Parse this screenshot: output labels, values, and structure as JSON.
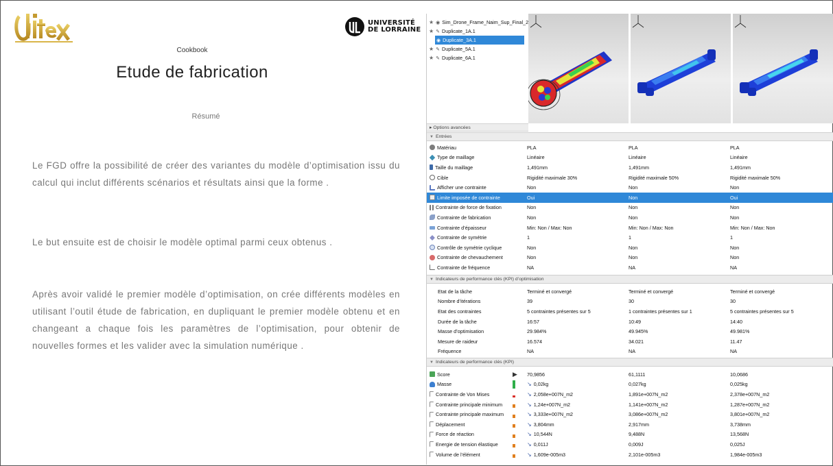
{
  "left": {
    "logo_ditex": "Ditex",
    "logo_ul": "UNIVERSITÉ\nDE LORRAINE",
    "ul_line1": "UNIVERSITÉ",
    "ul_line2": "DE LORRAINE",
    "cookbook": "Cookbook",
    "title": "Etude de fabrication",
    "resume": "Résumé",
    "paragraph1": "Le FGD offre la possibilité de créer des variantes du modèle d’optimisation issu du calcul qui inclut différents scénarios et résultats ainsi que la forme .",
    "paragraph2": " Le but ensuite est de choisir le modèle optimal parmi ceux obtenus .",
    "paragraph3": "Après avoir validé le premier modèle d’optimisation, on crée différents modèles en utilisant l’outil étude de fabrication, en dupliquant le premier modèle obtenu et en changeant a chaque fois les paramètres de l’optimisation, pour obtenir de nouvelles formes et les valider avec la simulation numérique ."
  },
  "tree": {
    "items": [
      {
        "label": "Sim_Drone_Frame_Naim_Sup_Final_2",
        "icon": "eye-icon"
      },
      {
        "label": "Duplicate_1A.1",
        "icon": "pin-icon"
      },
      {
        "label": "Duplicate_3A.1",
        "icon": "eye-icon",
        "selected": true
      },
      {
        "label": "Duplicate_5A.1",
        "icon": "pin-icon"
      },
      {
        "label": "Duplicate_6A.1",
        "icon": "pin-icon"
      }
    ],
    "options": "Options avancées"
  },
  "sections": {
    "entrees": "Entrées",
    "kpi_opt": "Indicateurs de performance clés (KPI) d’optimisation",
    "kpi": "Indicateurs de performance clés (KPI)"
  },
  "entrees": [
    {
      "label": "Matériau",
      "icon": "gear-icon",
      "v": [
        "PLA",
        "PLA",
        "PLA"
      ]
    },
    {
      "label": "Type de maillage",
      "icon": "mesh-icon",
      "v": [
        "Linéaire",
        "Linéaire",
        "Linéaire"
      ]
    },
    {
      "label": "Taille du maillage",
      "icon": "size-icon",
      "v": [
        "1,491mm",
        "1,491mm",
        "1,491mm"
      ]
    },
    {
      "label": "Cible",
      "icon": "target-icon",
      "v": [
        "Rigidité maximale 30%",
        "Rigidité maximale 50%",
        "Rigidité maximale 50%"
      ]
    },
    {
      "label": "Afficher une contrainte",
      "icon": "show-icon",
      "v": [
        "Non",
        "Non",
        "Non"
      ]
    },
    {
      "label": "Limite imposée de contrainte",
      "icon": "limit-icon",
      "v": [
        "Oui",
        "Non",
        "Oui"
      ],
      "highlight": true
    },
    {
      "label": "Contrainte de force de fixation",
      "icon": "fixation-icon",
      "v": [
        "Non",
        "Non",
        "Non"
      ]
    },
    {
      "label": "Contrainte de fabrication",
      "icon": "fabrication-icon",
      "v": [
        "Non",
        "Non",
        "Non"
      ]
    },
    {
      "label": "Contrainte d’épaisseur",
      "icon": "thickness-icon",
      "v": [
        "Min: Non / Max: Non",
        "Min: Non / Max: Non",
        "Min: Non / Max: Non"
      ]
    },
    {
      "label": "Contrainte de symétrie",
      "icon": "symmetry-icon",
      "v": [
        "1",
        "1",
        "1"
      ]
    },
    {
      "label": "Contrôle de symétrie cyclique",
      "icon": "cyclic-icon",
      "v": [
        "Non",
        "Non",
        "Non"
      ]
    },
    {
      "label": "Contrainte de chevauchement",
      "icon": "overlap-icon",
      "v": [
        "Non",
        "Non",
        "Non"
      ]
    },
    {
      "label": "Contrainte de fréquence",
      "icon": "frequency-icon",
      "v": [
        "NA",
        "NA",
        "NA"
      ]
    }
  ],
  "kpi_opt": [
    {
      "label": "Etat de la tâche",
      "v": [
        "Terminé et convergé",
        "Terminé et convergé",
        "Terminé et convergé"
      ]
    },
    {
      "label": "Nombre d’itérations",
      "v": [
        "39",
        "30",
        "30"
      ]
    },
    {
      "label": "Etat des contraintes",
      "v": [
        "5 contraintes présentes sur 5",
        "1 contraintes présentes sur 1",
        "5 contraintes présentes sur 5"
      ]
    },
    {
      "label": "Durée de la tâche",
      "v": [
        "16:57",
        "10:49",
        "14:40"
      ]
    },
    {
      "label": "Masse d’optimisation",
      "v": [
        "29.984%",
        "49.945%",
        "49.981%"
      ]
    },
    {
      "label": "Mesure de raideur",
      "v": [
        "16.574",
        "34.021",
        "11.47"
      ]
    },
    {
      "label": "Fréquence",
      "v": [
        "NA",
        "NA",
        "NA"
      ]
    }
  ],
  "kpi": [
    {
      "label": "Score",
      "icon": "score-icon",
      "v": [
        "70,9856",
        "61,1111",
        "10,0686"
      ],
      "arrow": "▶"
    },
    {
      "label": "Masse",
      "icon": "mass-icon",
      "v": [
        "0,02kg",
        "0,027kg",
        "0,025kg"
      ],
      "bar": "#2fae4a",
      "bar_level": 1.0
    },
    {
      "label": "Contrainte de Von Mises",
      "icon": "result-icon",
      "v": [
        "2,058e+007N_m2",
        "1,891e+007N_m2",
        "2,378e+007N_m2"
      ],
      "bar": "#d9302c",
      "bar_level": 0.25
    },
    {
      "label": "Contrainte principale minimum",
      "icon": "result-icon",
      "v": [
        "1,24e+007N_m2",
        "1,141e+007N_m2",
        "1,287e+007N_m2"
      ],
      "bar": "#e0801f",
      "bar_level": 0.4
    },
    {
      "label": "Contrainte principale maximum",
      "icon": "result-icon",
      "v": [
        "3,333e+007N_m2",
        "3,086e+007N_m2",
        "3,801e+007N_m2"
      ],
      "bar": "#e0801f",
      "bar_level": 0.4
    },
    {
      "label": "Déplacement",
      "icon": "result-icon",
      "v": [
        "3,804mm",
        "2,917mm",
        "3,738mm"
      ],
      "bar": "#e0801f",
      "bar_level": 0.4
    },
    {
      "label": "Force de réaction",
      "icon": "result-icon",
      "v": [
        "10,544N",
        "9,488N",
        "13,568N"
      ],
      "bar": "#e0801f",
      "bar_level": 0.4
    },
    {
      "label": "Energie de tension élastique",
      "icon": "result-icon",
      "v": [
        "0,011J",
        "0,009J",
        "0,025J"
      ],
      "bar": "#e0801f",
      "bar_level": 0.4
    },
    {
      "label": "Volume de l’élément",
      "icon": "result-icon",
      "v": [
        "1,609e-005m3",
        "2,101e-005m3",
        "1,984e-005m3"
      ],
      "bar": "#e0801f",
      "bar_level": 0.4
    }
  ],
  "colors": {
    "selection": "#2f88d8",
    "section_bg": "#ececec",
    "text_grey": "#777777"
  }
}
